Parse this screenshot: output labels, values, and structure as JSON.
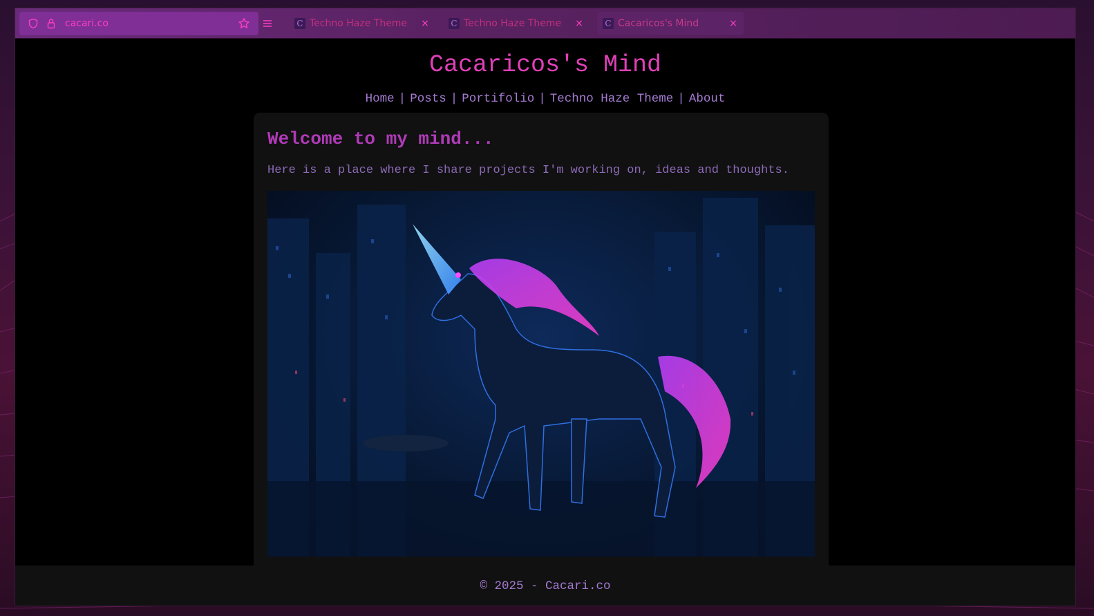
{
  "browser": {
    "url": "cacari.co",
    "tabs": [
      {
        "label": "Techno Haze Theme",
        "active": false
      },
      {
        "label": "Techno Haze Theme",
        "active": false
      },
      {
        "label": "Cacaricos's Mind",
        "active": true
      }
    ],
    "favicon_glyph": "C",
    "close_glyph": "×"
  },
  "site": {
    "title": "Cacaricos's Mind",
    "nav": {
      "items": [
        "Home",
        "Posts",
        "Portifolio",
        "Techno Haze Theme",
        "About"
      ],
      "separator": "|"
    }
  },
  "main": {
    "heading": "Welcome to my mind...",
    "intro": "Here is a place where I share projects I'm working on, ideas and thoughts."
  },
  "footer": {
    "text": "© 2025 - Cacari.co"
  },
  "colors": {
    "accent_pink": "#e040b8",
    "link_purple": "#a57bd2",
    "card_bg": "#111111",
    "page_bg": "#000000"
  },
  "icons": [
    "shield-icon",
    "lock-icon",
    "star-icon",
    "hamburger-menu-icon",
    "close-icon"
  ]
}
